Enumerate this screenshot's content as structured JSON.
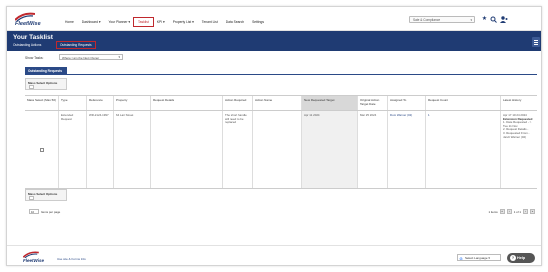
{
  "brand": {
    "name": "FleetWise"
  },
  "nav": {
    "items": [
      {
        "label": "Home"
      },
      {
        "label": "Dashboard ▾"
      },
      {
        "label": "Your Planner ▾"
      },
      {
        "label": "Tasklist"
      },
      {
        "label": "KPI ▾"
      },
      {
        "label": "Property List ▾"
      },
      {
        "label": "Tenant List"
      },
      {
        "label": "Data Search"
      },
      {
        "label": "Settings"
      }
    ],
    "active_index": 3,
    "scope_select": "Sale & Compliance"
  },
  "header": {
    "title": "Your Tasklist",
    "subtitle": "Outstanding Actions",
    "active_subtab": "Outstanding Requests"
  },
  "filters": {
    "show_tasks_label": "Show Tasks:",
    "show_tasks_value": "Where I am the Next Owner"
  },
  "tab": {
    "label": "Outstanding Requests"
  },
  "mass_select": {
    "label": "Mass Select Options"
  },
  "table": {
    "columns": [
      "Mass Select (Max 50)",
      "Type",
      "Reference",
      "Property",
      "Request Details",
      "Action Required",
      "Action Name",
      "New Requested Target",
      "Original Action Target Date",
      "Assigned To",
      "Request Count",
      "Latest History"
    ],
    "row": {
      "type": "Extended Request",
      "reference": "WR-2124-1997",
      "property": "64 Lari Street",
      "request_details": "",
      "action_required": "The short handle will need to be replaced",
      "action_name": "",
      "new_target": "Apr 11 2024",
      "original_target": "Mar 25 2024",
      "assigned_to": "Dom Warner (02)",
      "request_count": "1",
      "history_head": "Apr 17 10:24 2024",
      "history_lines": [
        "Extension Requested",
        "1. Date Requested - > Tue 11 Nov",
        "2. Request Details -",
        "3. Requested From - Jarvit Warner (02)"
      ]
    }
  },
  "pager": {
    "page_size": "10",
    "items_per_page": "Items per page",
    "count_text": "1 items",
    "page_text": "1 of 1"
  },
  "footer": {
    "terms": "Use site & Forms Info",
    "language": "Select Language ▾",
    "help": "Help"
  },
  "colors": {
    "brand_navy": "#1f3b73",
    "highlight_red": "#c0282d"
  }
}
